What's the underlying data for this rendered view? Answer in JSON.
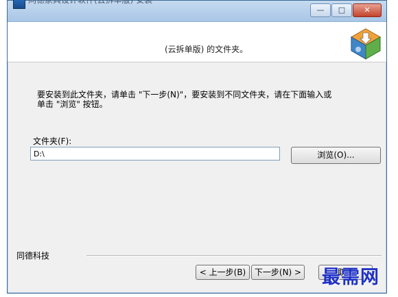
{
  "window": {
    "title": "同德家具设计软件(云拆单版) 安装",
    "controls": {
      "minimize": "—",
      "maximize": "□",
      "close": "✕"
    }
  },
  "header": {
    "text": "(云拆单版) 的文件夹。",
    "logo_icon": "installer-box-icon"
  },
  "body": {
    "instruction": "要安装到此文件夹，请单击 \"下一步(N)\"，要安装到不同文件夹，请在下面输入或\n单击 \"浏览\" 按钮。",
    "folder_label": "文件夹(F):",
    "folder_value": "D:\\",
    "browse_label": "浏览(O)..."
  },
  "footer": {
    "brand": "同德科技",
    "back_label": "< 上一步(B)",
    "next_label": "下一步(N) >",
    "cancel_label": "取消"
  },
  "watermark": "最需网",
  "colors": {
    "title_bar": "#b9d1ea",
    "close_button": "#c3442b",
    "watermark": "#1f31c4"
  }
}
